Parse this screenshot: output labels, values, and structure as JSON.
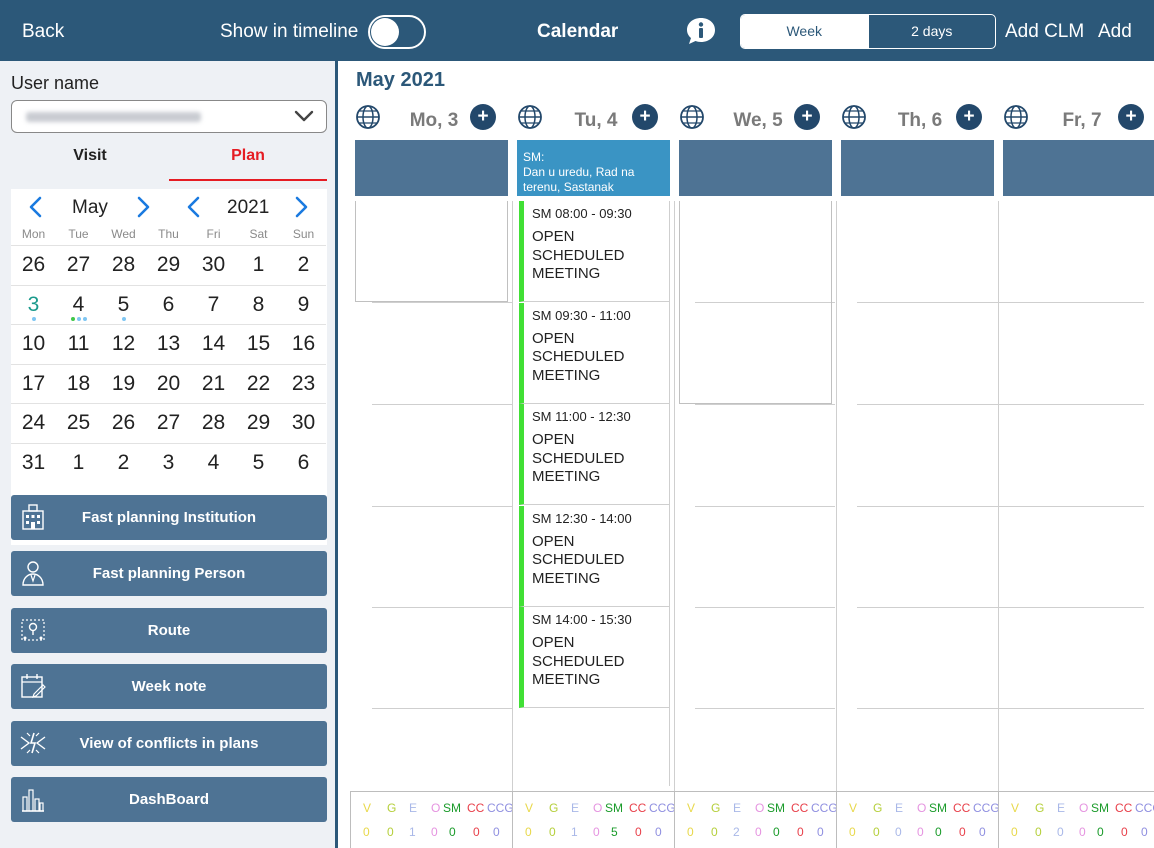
{
  "topbar": {
    "back": "Back",
    "show_in_timeline": "Show in timeline",
    "title": "Calendar",
    "seg_week": "Week",
    "seg_2days": "2 days",
    "add_clm": "Add CLM",
    "add": "Add"
  },
  "left": {
    "username_label": "User name",
    "tab_visit": "Visit",
    "tab_plan": "Plan",
    "month": "May",
    "year": "2021",
    "weekdays": [
      "Mon",
      "Tue",
      "Wed",
      "Thu",
      "Fri",
      "Sat",
      "Sun"
    ],
    "weeks": [
      [
        "26",
        "27",
        "28",
        "29",
        "30",
        "1",
        "2"
      ],
      [
        "3",
        "4",
        "5",
        "6",
        "7",
        "8",
        "9"
      ],
      [
        "10",
        "11",
        "12",
        "13",
        "14",
        "15",
        "16"
      ],
      [
        "17",
        "18",
        "19",
        "20",
        "21",
        "22",
        "23"
      ],
      [
        "24",
        "25",
        "26",
        "27",
        "28",
        "29",
        "30"
      ],
      [
        "31",
        "1",
        "2",
        "3",
        "4",
        "5",
        "6"
      ]
    ],
    "buttons": [
      {
        "label": "Fast planning Institution",
        "icon": "hospital-icon"
      },
      {
        "label": "Fast planning Person",
        "icon": "person-icon"
      },
      {
        "label": "Route",
        "icon": "route-icon"
      },
      {
        "label": "Week note",
        "icon": "note-icon"
      },
      {
        "label": "View of conflicts in plans",
        "icon": "conflict-icon"
      },
      {
        "label": "DashBoard",
        "icon": "dashboard-icon"
      }
    ]
  },
  "main": {
    "month_title": "May 2021",
    "days": [
      "Mo, 3",
      "Tu, 4",
      "We, 5",
      "Th, 6",
      "Fr, 7"
    ],
    "sm_note": "SM:\nDan u uredu, Rad na terenu, Sastanak",
    "events": [
      {
        "time": "SM 08:00 - 09:30",
        "title": "OPEN SCHEDULED MEETING"
      },
      {
        "time": "SM 09:30 - 11:00",
        "title": "OPEN SCHEDULED MEETING"
      },
      {
        "time": "SM 11:00 - 12:30",
        "title": "OPEN SCHEDULED MEETING"
      },
      {
        "time": "SM 12:30 - 14:00",
        "title": "OPEN SCHEDULED MEETING"
      },
      {
        "time": "SM 14:00 - 15:30",
        "title": "OPEN SCHEDULED MEETING"
      }
    ],
    "footer_keys": [
      "V",
      "G",
      "E",
      "O",
      "SM",
      "CC",
      "CCG"
    ],
    "footer_colors": [
      "#e8d84a",
      "#b5cf3a",
      "#a9b8e8",
      "#e593e0",
      "#1a9b2a",
      "#e8404a",
      "#8f8fe0"
    ],
    "footer_values": [
      [
        "0",
        "0",
        "1",
        "0",
        "0",
        "0",
        "0"
      ],
      [
        "0",
        "0",
        "1",
        "0",
        "5",
        "0",
        "0"
      ],
      [
        "0",
        "0",
        "2",
        "0",
        "0",
        "0",
        "0"
      ],
      [
        "0",
        "0",
        "0",
        "0",
        "0",
        "0",
        "0"
      ],
      [
        "0",
        "0",
        "0",
        "0",
        "0",
        "0",
        "0"
      ]
    ]
  }
}
